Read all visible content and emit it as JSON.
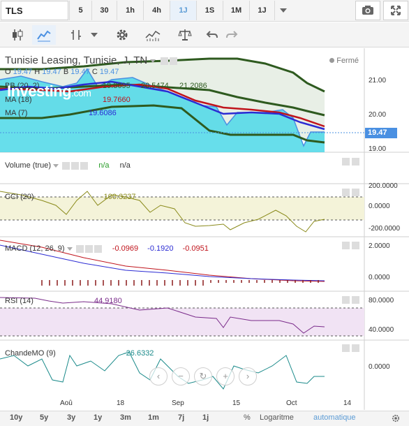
{
  "toolbar": {
    "symbol": "TLS",
    "timeframes": [
      "5",
      "30",
      "1h",
      "4h",
      "1J",
      "1S",
      "1M",
      "1J"
    ],
    "active_timeframe": "1J"
  },
  "main_pane": {
    "title": "Tunisie Leasing, Tunisie, J, TN",
    "status": "Fermé",
    "ohlc": {
      "o_label": "O",
      "o": "19.47",
      "h_label": "H",
      "h": "19.47",
      "b_label": "B",
      "b": "19.47",
      "c_label": "C",
      "c": "19.47"
    },
    "bb_label": "BB (20, 2)",
    "bb_values": [
      "19.8695",
      "20.5474",
      "21.2086"
    ],
    "ma18_label": "MA (18)",
    "ma18_value": "19.7660",
    "ma7_label": "MA (7)",
    "ma7_value": "19.6086",
    "yticks": [
      "21.00",
      "20.00",
      "19.00"
    ],
    "last_price": "19.47",
    "logo": "Investing",
    "logo_suffix": ".com"
  },
  "volume_pane": {
    "label": "Volume (true)",
    "v1": "n/a",
    "v2": "n/a"
  },
  "cci_pane": {
    "label": "CCI (20)",
    "value": "-100.3237",
    "yticks": [
      "200.0000",
      "0.0000",
      "-200.0000"
    ]
  },
  "macd_pane": {
    "label": "MACD (12, 26, 9)",
    "v1": "-0.0969",
    "v2": "-0.1920",
    "v3": "-0.0951",
    "yticks": [
      "2.0000",
      "0.0000"
    ]
  },
  "rsi_pane": {
    "label": "RSI (14)",
    "value": "44.9180",
    "yticks": [
      "80.0000",
      "40.0000"
    ]
  },
  "chandemo_pane": {
    "label": "ChandeMO (9)",
    "value": "-26.6332",
    "ytick": "0.0000"
  },
  "xaxis": [
    "Aoû",
    "18",
    "Sep",
    "15",
    "Oct",
    "14"
  ],
  "bottombar": {
    "ranges": [
      "10y",
      "5y",
      "3y",
      "1y",
      "3m",
      "1m",
      "7j",
      "1j"
    ],
    "percent": "%",
    "log": "Logaritme",
    "auto": "automatique"
  },
  "colors": {
    "bb_fill": "#4cd8e8",
    "bb_band": "#2e5a1f",
    "ma18": "#c0141c",
    "ma7": "#2b2bd3",
    "price": "#4a90e2",
    "accent": "#5b9bd5"
  }
}
